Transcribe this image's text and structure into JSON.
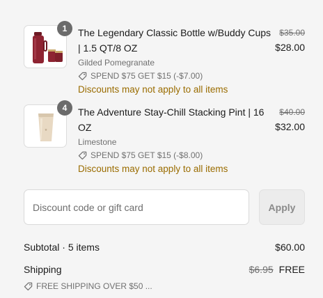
{
  "line_items": [
    {
      "quantity": "1",
      "title": "The Legendary Classic Bottle w/Buddy Cups | 1.5 QT/8 OZ",
      "variant": "Gilded Pomegranate",
      "discount": "SPEND $75 GET $15 (-$7.00)",
      "warning": "Discounts may not apply to all items",
      "original_price": "$35.00",
      "price": "$28.00",
      "image_icon": "red-thermos-bottle-icon"
    },
    {
      "quantity": "4",
      "title": "The Adventure Stay-Chill Stacking Pint | 16 OZ",
      "variant": "Limestone",
      "discount": "SPEND $75 GET $15 (-$8.00)",
      "warning": "Discounts may not apply to all items",
      "original_price": "$40.00",
      "price": "$32.00",
      "image_icon": "beige-pint-cup-icon"
    }
  ],
  "discount_code": {
    "placeholder": "Discount code or gift card",
    "value": "",
    "apply_label": "Apply"
  },
  "summary": {
    "subtotal_label": "Subtotal · 5 items",
    "subtotal_value": "$60.00",
    "shipping_label": "Shipping",
    "shipping_original": "$6.95",
    "shipping_value": "FREE",
    "shipping_promo": "FREE SHIPPING OVER $50 ..."
  },
  "colors": {
    "background": "#f5f5f5",
    "warning_text": "#9a6c00",
    "muted_text": "#707070",
    "badge": "#6b6b6b"
  }
}
